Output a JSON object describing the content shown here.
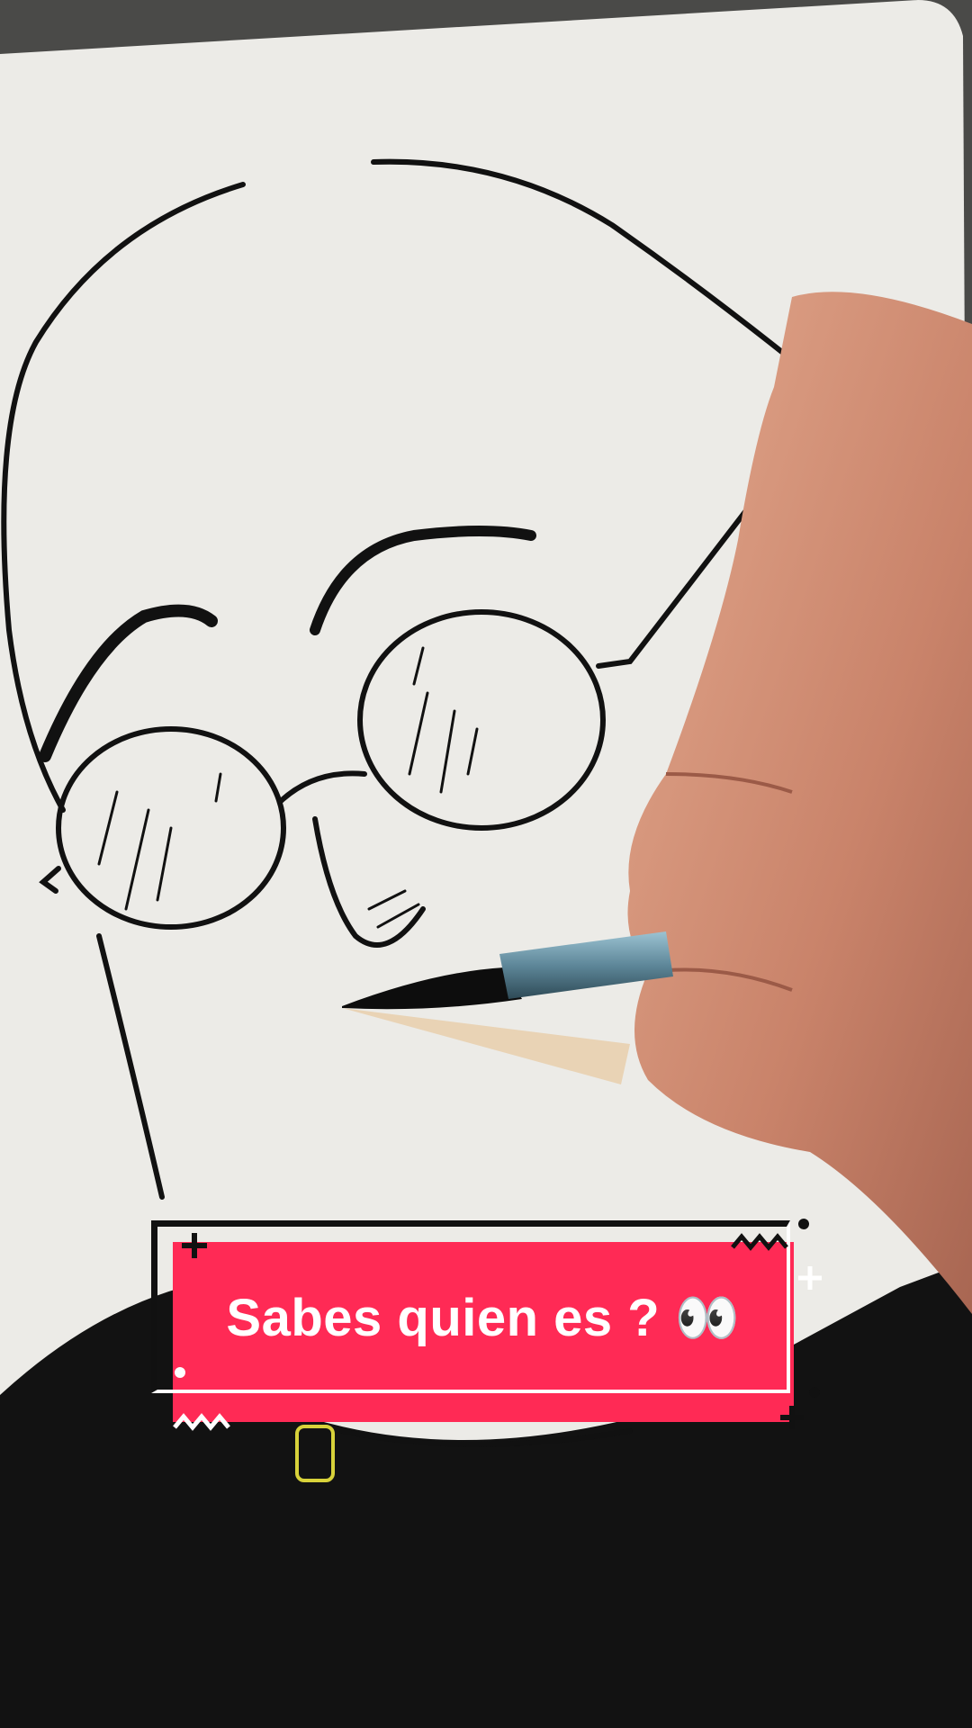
{
  "caption": {
    "text": "Sabes quien es ? 👀"
  },
  "colors": {
    "caption_bg": "#ff2a55",
    "paper": "#ecebe7",
    "ink": "#111111",
    "skin": "#d9977b",
    "brush_ferrule": "#6f9bb0"
  },
  "icons": [
    "plus-icon",
    "zigzag-icon",
    "dot-icon",
    "eyes-emoji-icon"
  ]
}
